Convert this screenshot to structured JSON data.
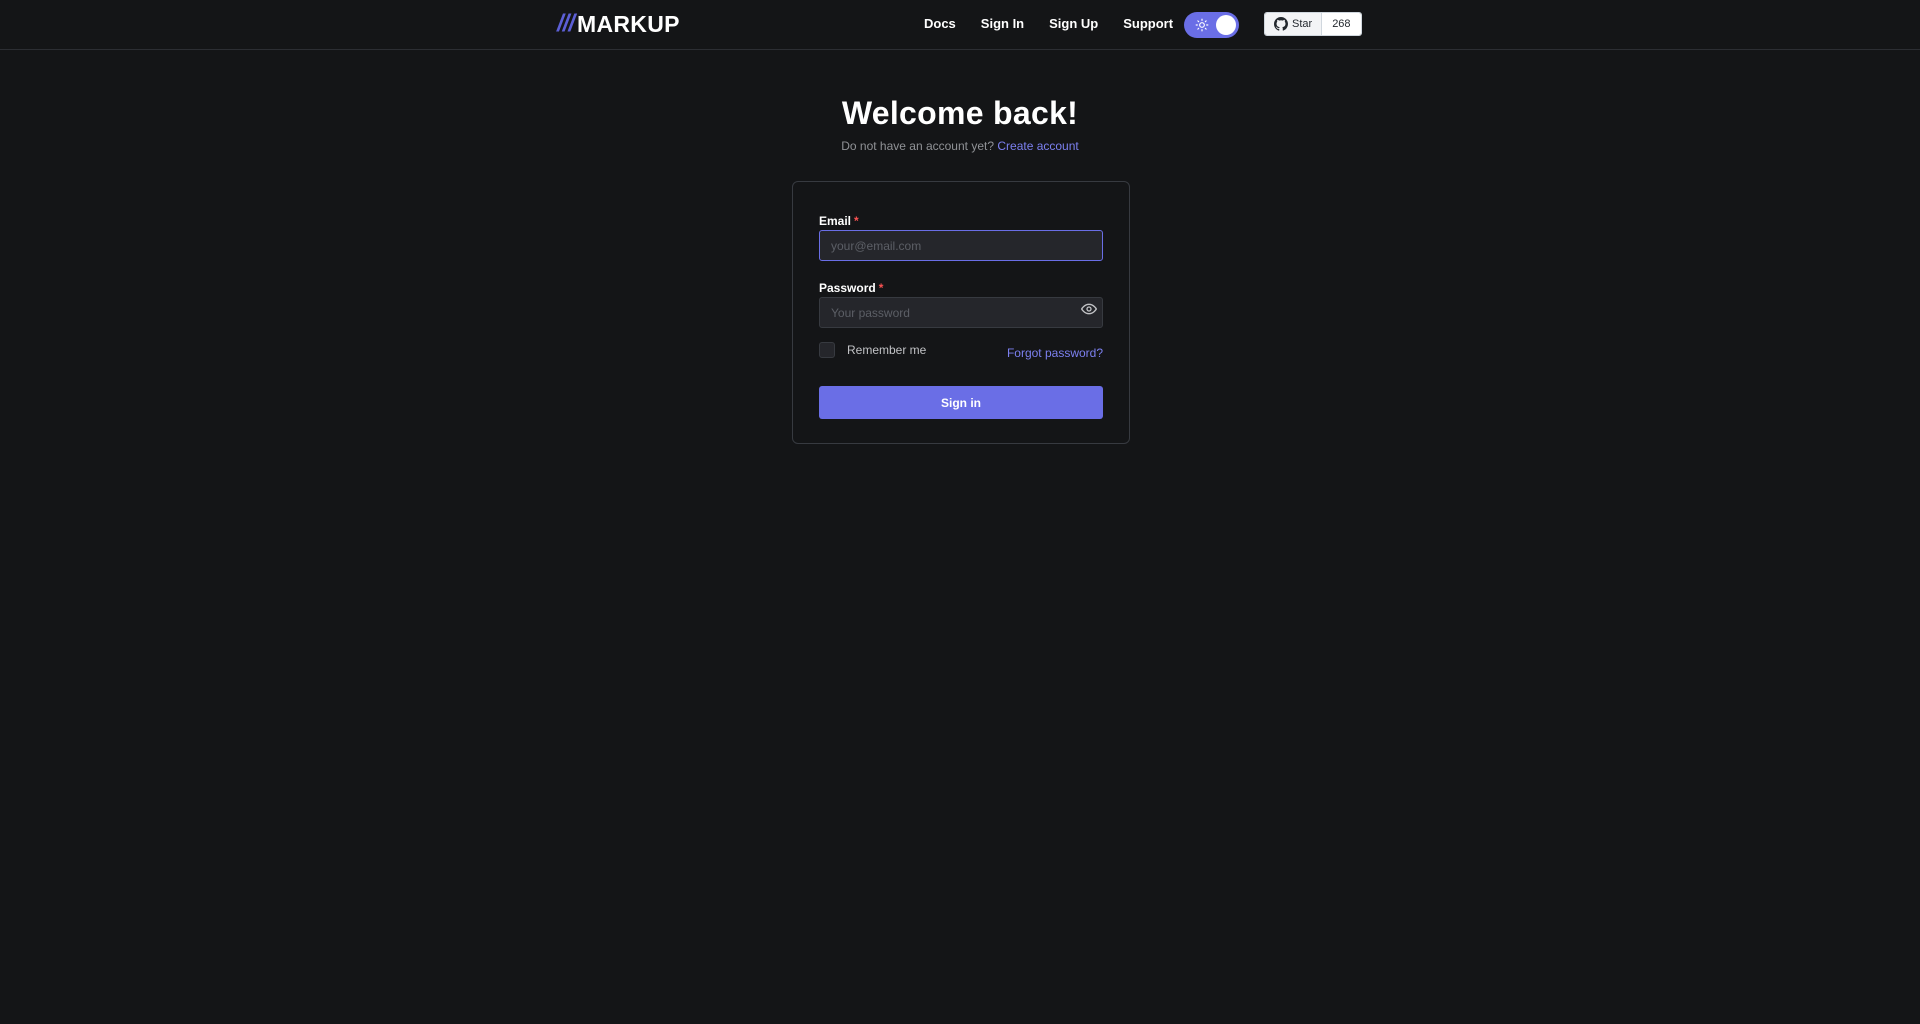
{
  "header": {
    "logo_slashes": "///",
    "logo_text": "MARKUP",
    "nav": [
      {
        "label": "Docs"
      },
      {
        "label": "Sign In"
      },
      {
        "label": "Sign Up"
      },
      {
        "label": "Support"
      }
    ],
    "theme_toggle_icon": "sun-icon",
    "github": {
      "star_label": "Star",
      "count": "268",
      "icon": "github-icon"
    }
  },
  "main": {
    "title": "Welcome back!",
    "subtitle_text": "Do not have an account yet?",
    "create_account_link": "Create account"
  },
  "form": {
    "email_label": "Email",
    "email_placeholder": "your@email.com",
    "email_value": "",
    "password_label": "Password",
    "password_placeholder": "Your password",
    "password_value": "",
    "required_mark": "*",
    "show_password_icon": "eye-icon",
    "remember_label": "Remember me",
    "remember_checked": false,
    "forgot_link": "Forgot password?",
    "submit_label": "Sign in"
  },
  "colors": {
    "background": "#141517",
    "accent": "#6a6ee6",
    "link": "#7c80f0",
    "required": "#fa5252"
  }
}
